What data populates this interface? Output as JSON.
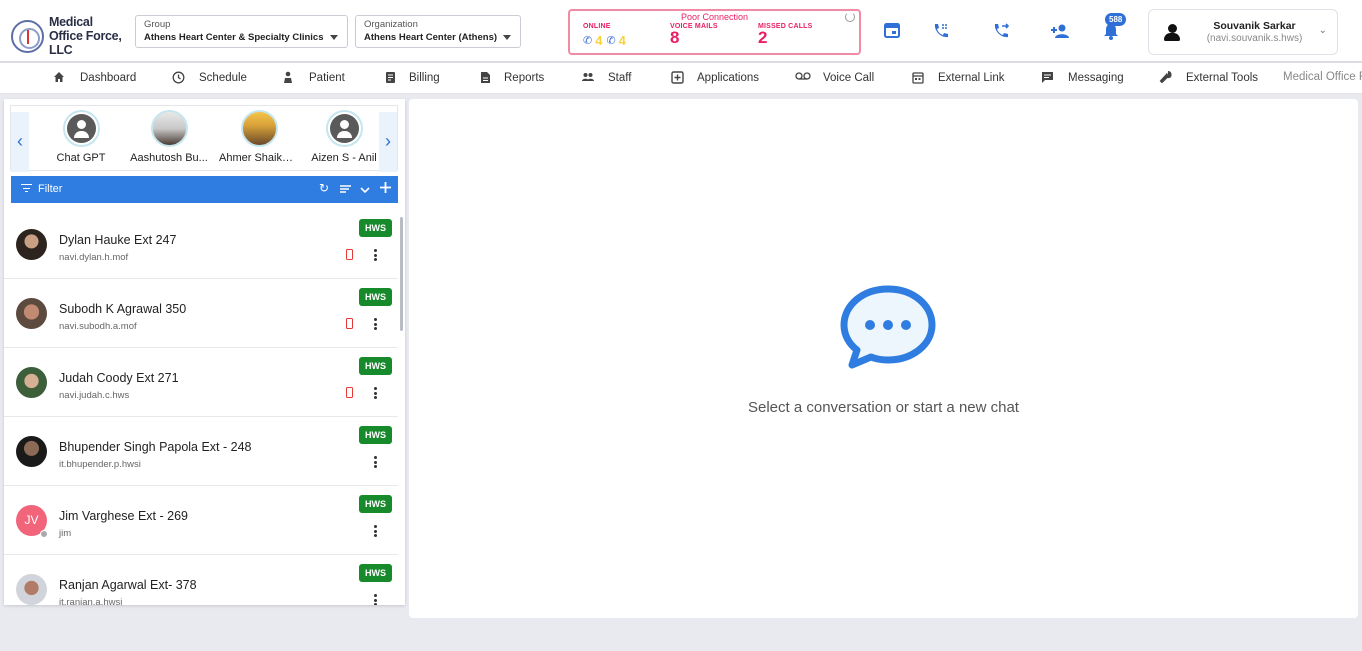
{
  "header": {
    "logo_text": "Medical Office Force, LLC",
    "group": {
      "label": "Group",
      "value": "Athens Heart Center & Specialty Clinics"
    },
    "organization": {
      "label": "Organization",
      "value": "Athens Heart Center (Athens)"
    },
    "status": {
      "title": "Poor Connection",
      "online_label": "ONLINE",
      "online_values": [
        "4",
        "4"
      ],
      "voicemail_label": "VOICE MAILS",
      "voicemail_count": "8",
      "missed_label": "MISSED CALLS",
      "missed_count": "2"
    },
    "notification_badge": "588",
    "user": {
      "name": "Souvanik Sarkar",
      "username": "(navi.souvanik.s.hws)"
    }
  },
  "nav": [
    {
      "label": "Dashboard",
      "icon": "home-icon"
    },
    {
      "label": "Schedule",
      "icon": "clock-icon"
    },
    {
      "label": "Patient",
      "icon": "patient-icon"
    },
    {
      "label": "Billing",
      "icon": "billing-icon"
    },
    {
      "label": "Reports",
      "icon": "document-icon"
    },
    {
      "label": "Staff",
      "icon": "staff-icon"
    },
    {
      "label": "Applications",
      "icon": "applications-icon"
    },
    {
      "label": "Voice Call",
      "icon": "voicemail-icon"
    },
    {
      "label": "External Link",
      "icon": "external-link-icon"
    },
    {
      "label": "Messaging",
      "icon": "message-icon"
    },
    {
      "label": "External Tools",
      "icon": "wrench-icon"
    },
    {
      "label": "Medical Office Fo",
      "icon": ""
    }
  ],
  "quick_contacts": [
    {
      "name": "Chat GPT"
    },
    {
      "name": "Aashutosh Bu..."
    },
    {
      "name": "Ahmer Shaikh ..."
    },
    {
      "name": "Aizen S - Anil"
    }
  ],
  "filter": {
    "label": "Filter"
  },
  "chats": [
    {
      "name": "Dylan Hauke Ext 247",
      "username": "navi.dylan.h.mof",
      "tag": "HWS",
      "mobile": true
    },
    {
      "name": "Subodh K Agrawal 350",
      "username": "navi.subodh.a.mof",
      "tag": "HWS",
      "mobile": true
    },
    {
      "name": "Judah Coody Ext 271",
      "username": "navi.judah.c.hws",
      "tag": "HWS",
      "mobile": true
    },
    {
      "name": "Bhupender Singh Papola Ext - 248",
      "username": "it.bhupender.p.hwsi",
      "tag": "HWS",
      "mobile": false
    },
    {
      "name": "Jim Varghese Ext - 269",
      "username": "jim",
      "tag": "HWS",
      "mobile": false,
      "initials": "JV"
    },
    {
      "name": "Ranjan Agarwal Ext- 378",
      "username": "it.ranjan.a.hwsi",
      "tag": "HWS",
      "mobile": false
    }
  ],
  "empty_state": {
    "message": "Select a conversation or start a new chat"
  },
  "colors": {
    "accent": "#2f7de1",
    "status_pink": "#e91e63",
    "hws_green": "#178a2b"
  }
}
